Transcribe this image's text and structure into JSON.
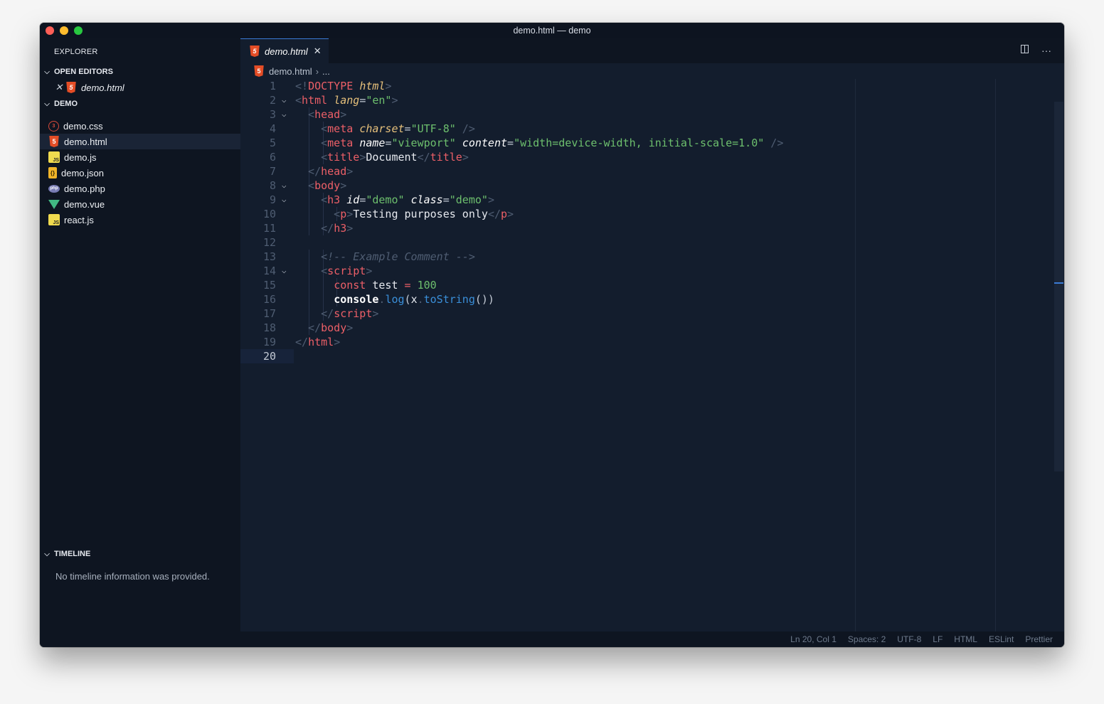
{
  "window": {
    "title": "demo.html — demo"
  },
  "sidebar": {
    "title": "EXPLORER",
    "open_editors": {
      "label": "OPEN EDITORS",
      "items": [
        {
          "name": "demo.html",
          "icon": "html5-icon"
        }
      ]
    },
    "project": {
      "label": "DEMO",
      "files": [
        {
          "name": "demo.css",
          "icon": "css-icon"
        },
        {
          "name": "demo.html",
          "icon": "html5-icon",
          "active": true
        },
        {
          "name": "demo.js",
          "icon": "js-icon"
        },
        {
          "name": "demo.json",
          "icon": "json-icon"
        },
        {
          "name": "demo.php",
          "icon": "php-icon"
        },
        {
          "name": "demo.vue",
          "icon": "vue-icon"
        },
        {
          "name": "react.js",
          "icon": "js-icon"
        }
      ]
    },
    "timeline": {
      "label": "TIMELINE",
      "message": "No timeline information was provided."
    }
  },
  "editor": {
    "tab": {
      "label": "demo.html"
    },
    "breadcrumb": {
      "file": "demo.html",
      "rest": "..."
    },
    "lines": [
      [
        [
          "punct",
          "<!"
        ],
        [
          "tag",
          "DOCTYPE"
        ],
        [
          "punct",
          " "
        ],
        [
          "attr",
          "html"
        ],
        [
          "punct",
          ">"
        ]
      ],
      [
        [
          "punct",
          "<"
        ],
        [
          "tag",
          "html"
        ],
        [
          "punct",
          " "
        ],
        [
          "attr",
          "lang"
        ],
        [
          "eq",
          "="
        ],
        [
          "str",
          "\"en\""
        ],
        [
          "punct",
          ">"
        ]
      ],
      [
        [
          "punct",
          "  <"
        ],
        [
          "tag",
          "head"
        ],
        [
          "punct",
          ">"
        ]
      ],
      [
        [
          "punct",
          "    <"
        ],
        [
          "tag",
          "meta"
        ],
        [
          "punct",
          " "
        ],
        [
          "attr",
          "charset"
        ],
        [
          "eq",
          "="
        ],
        [
          "str",
          "\"UTF-8\""
        ],
        [
          "punct",
          " />"
        ]
      ],
      [
        [
          "punct",
          "    <"
        ],
        [
          "tag",
          "meta"
        ],
        [
          "punct",
          " "
        ],
        [
          "attrn",
          "name"
        ],
        [
          "eq",
          "="
        ],
        [
          "str",
          "\"viewport\""
        ],
        [
          "punct",
          " "
        ],
        [
          "attrn",
          "content"
        ],
        [
          "eq",
          "="
        ],
        [
          "str",
          "\"width=device-width, initial-scale=1.0\""
        ],
        [
          "punct",
          " />"
        ]
      ],
      [
        [
          "punct",
          "    <"
        ],
        [
          "tag",
          "title"
        ],
        [
          "punct",
          ">"
        ],
        [
          "text",
          "Document"
        ],
        [
          "punct",
          "</"
        ],
        [
          "tag",
          "title"
        ],
        [
          "punct",
          ">"
        ]
      ],
      [
        [
          "punct",
          "  </"
        ],
        [
          "tag",
          "head"
        ],
        [
          "punct",
          ">"
        ]
      ],
      [
        [
          "punct",
          "  <"
        ],
        [
          "tag",
          "body"
        ],
        [
          "punct",
          ">"
        ]
      ],
      [
        [
          "punct",
          "    <"
        ],
        [
          "tag",
          "h3"
        ],
        [
          "punct",
          " "
        ],
        [
          "attrn",
          "id"
        ],
        [
          "eq",
          "="
        ],
        [
          "str",
          "\"demo\""
        ],
        [
          "punct",
          " "
        ],
        [
          "attrn",
          "class"
        ],
        [
          "eq",
          "="
        ],
        [
          "str",
          "\"demo\""
        ],
        [
          "punct",
          ">"
        ]
      ],
      [
        [
          "punct",
          "      <"
        ],
        [
          "tag",
          "p"
        ],
        [
          "punct",
          ">"
        ],
        [
          "text",
          "Testing purposes only"
        ],
        [
          "punct",
          "</"
        ],
        [
          "tag",
          "p"
        ],
        [
          "punct",
          ">"
        ]
      ],
      [
        [
          "punct",
          "    </"
        ],
        [
          "tag",
          "h3"
        ],
        [
          "punct",
          ">"
        ]
      ],
      [],
      [
        [
          "cmt",
          "    <!-- Example Comment -->"
        ]
      ],
      [
        [
          "punct",
          "    <"
        ],
        [
          "tag",
          "script"
        ],
        [
          "punct",
          ">"
        ]
      ],
      [
        [
          "punct",
          "      "
        ],
        [
          "kw",
          "const"
        ],
        [
          "punct",
          " "
        ],
        [
          "text",
          "test"
        ],
        [
          "punct",
          " "
        ],
        [
          "kw",
          "="
        ],
        [
          "punct",
          " "
        ],
        [
          "num",
          "100"
        ]
      ],
      [
        [
          "punct",
          "      "
        ],
        [
          "obj",
          "console"
        ],
        [
          "punct",
          "."
        ],
        [
          "fn",
          "log"
        ],
        [
          "eq",
          "("
        ],
        [
          "text",
          "x"
        ],
        [
          "punct",
          "."
        ],
        [
          "fn",
          "toString"
        ],
        [
          "eq",
          "())"
        ]
      ],
      [
        [
          "punct",
          "    </"
        ],
        [
          "tag",
          "script"
        ],
        [
          "punct",
          ">"
        ]
      ],
      [
        [
          "punct",
          "  </"
        ],
        [
          "tag",
          "body"
        ],
        [
          "punct",
          ">"
        ]
      ],
      [
        [
          "punct",
          "</"
        ],
        [
          "tag",
          "html"
        ],
        [
          "punct",
          ">"
        ]
      ],
      []
    ],
    "folds": [
      2,
      3,
      8,
      9,
      14
    ],
    "current_line": 20
  },
  "statusbar": {
    "position": "Ln 20, Col 1",
    "spaces": "Spaces: 2",
    "encoding": "UTF-8",
    "eol": "LF",
    "language": "HTML",
    "eslint": "ESLint",
    "prettier": "Prettier"
  }
}
